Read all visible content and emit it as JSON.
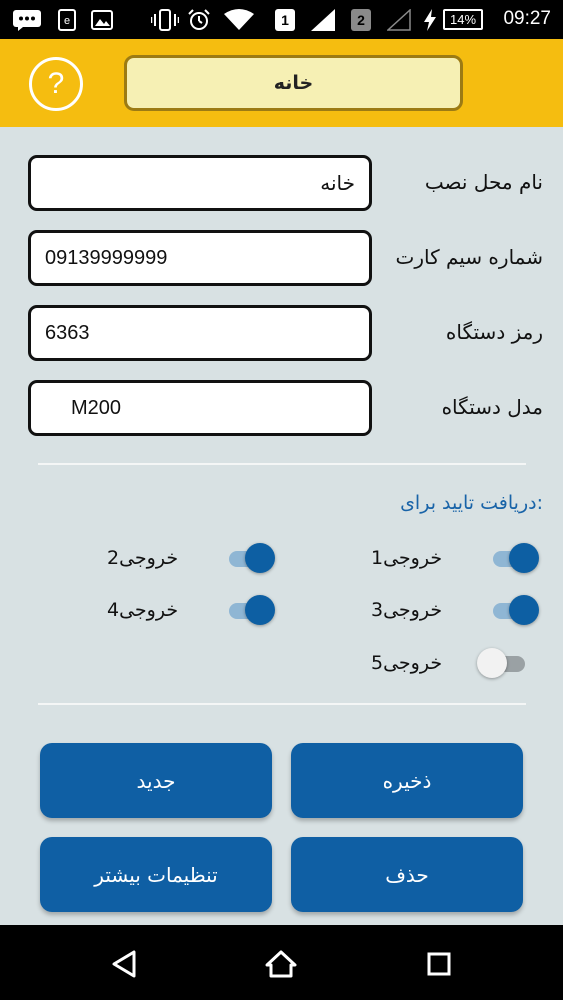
{
  "status_bar": {
    "time": "09:27",
    "battery": "14%",
    "sim1": "1",
    "sim2": "2",
    "icons": [
      "message-icon",
      "app-notification-icon",
      "image-icon",
      "vibrate-icon",
      "alarm-icon",
      "wifi-icon",
      "sim1-signal-icon",
      "sim2-signal-icon",
      "charging-icon",
      "battery-icon"
    ]
  },
  "header": {
    "help_symbol": "?",
    "title": "خانه",
    "bg_color": "#f5bd10"
  },
  "form": {
    "install_location": {
      "label": "نام محل نصب",
      "value": "خانه"
    },
    "sim_number": {
      "label": "شماره سیم کارت",
      "value": "09139999999"
    },
    "device_password": {
      "label": "رمز دستگاه",
      "value": "6363"
    },
    "device_model": {
      "label": "مدل دستگاه",
      "value": "M200"
    }
  },
  "confirmation": {
    "title": "دریافت تایید برای:",
    "outputs": [
      {
        "label": "خروجی1",
        "enabled": true
      },
      {
        "label": "خروجی2",
        "enabled": true
      },
      {
        "label": "خروجی3",
        "enabled": true
      },
      {
        "label": "خروجی4",
        "enabled": true
      },
      {
        "label": "خروجی5",
        "enabled": false
      }
    ]
  },
  "actions": {
    "save": "ذخیره",
    "new": "جدید",
    "delete": "حذف",
    "more_settings": "تنظیمات بیشتر",
    "color": "#0f5fa4"
  },
  "nav": {
    "icons": [
      "back-icon",
      "home-icon",
      "recents-icon"
    ]
  }
}
